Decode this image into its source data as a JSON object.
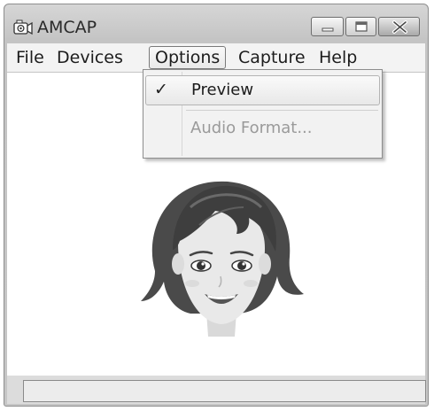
{
  "window": {
    "title": "AMCAP",
    "app_icon": "webcam-icon",
    "controls": [
      "minimize-icon",
      "maximize-icon",
      "close-icon"
    ]
  },
  "menubar": {
    "items": [
      {
        "label": "File"
      },
      {
        "label": "Devices"
      },
      {
        "label": "Options",
        "active": true
      },
      {
        "label": "Capture"
      },
      {
        "label": "Help"
      }
    ]
  },
  "options_menu": {
    "items": [
      {
        "label": "Preview",
        "checked": true,
        "enabled": true,
        "check_glyph": "✓"
      },
      {
        "label": "Audio Format...",
        "checked": false,
        "enabled": false
      }
    ]
  },
  "preview": {
    "image": "cartoon-woman-face-avatar"
  },
  "statusbar": {
    "text": ""
  }
}
